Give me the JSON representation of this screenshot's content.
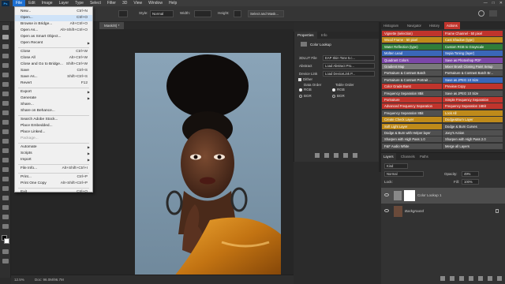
{
  "menubar": {
    "logo": "Ps",
    "items": [
      "File",
      "Edit",
      "Image",
      "Layer",
      "Type",
      "Select",
      "Filter",
      "3D",
      "View",
      "Window",
      "Help"
    ]
  },
  "options": {
    "style_label": "Style:",
    "style_value": "Normal",
    "width_label": "Width:",
    "height_label": "Height:",
    "select_mask_button": "Select and Mask..."
  },
  "document": {
    "tab_title": "Mask/8) *"
  },
  "status": {
    "zoom": "12.5%",
    "doc_size": "Doc: 96.0M/96.7M"
  },
  "file_menu": {
    "items": [
      {
        "label": "New...",
        "shortcut": "Ctrl+N",
        "state": "normal"
      },
      {
        "label": "Open...",
        "shortcut": "Ctrl+O",
        "state": "highlight"
      },
      {
        "label": "Browse in Bridge...",
        "shortcut": "Alt+Ctrl+O",
        "state": "normal"
      },
      {
        "label": "Open As...",
        "shortcut": "Alt+Shift+Ctrl+O",
        "state": "normal"
      },
      {
        "label": "Open as Smart Object...",
        "shortcut": "",
        "state": "normal"
      },
      {
        "label": "Open Recent",
        "shortcut": "",
        "state": "submenu"
      },
      {
        "label": "Close",
        "shortcut": "Ctrl+W",
        "state": "normal"
      },
      {
        "label": "Close All",
        "shortcut": "Alt+Ctrl+W",
        "state": "normal"
      },
      {
        "label": "Close and Go to Bridge...",
        "shortcut": "Shift+Ctrl+W",
        "state": "normal"
      },
      {
        "label": "Save",
        "shortcut": "Ctrl+S",
        "state": "normal"
      },
      {
        "label": "Save As...",
        "shortcut": "Shift+Ctrl+S",
        "state": "normal"
      },
      {
        "label": "Revert",
        "shortcut": "F12",
        "state": "normal"
      },
      {
        "label": "Export",
        "shortcut": "",
        "state": "submenu"
      },
      {
        "label": "Generate",
        "shortcut": "",
        "state": "submenu"
      },
      {
        "label": "Share...",
        "shortcut": "",
        "state": "normal"
      },
      {
        "label": "Share on Behance...",
        "shortcut": "",
        "state": "normal"
      },
      {
        "label": "Search Adobe Stock...",
        "shortcut": "",
        "state": "normal"
      },
      {
        "label": "Place Embedded...",
        "shortcut": "",
        "state": "normal"
      },
      {
        "label": "Place Linked...",
        "shortcut": "",
        "state": "normal"
      },
      {
        "label": "Package...",
        "shortcut": "",
        "state": "disabled"
      },
      {
        "label": "Automate",
        "shortcut": "",
        "state": "submenu"
      },
      {
        "label": "Scripts",
        "shortcut": "",
        "state": "submenu"
      },
      {
        "label": "Import",
        "shortcut": "",
        "state": "submenu"
      },
      {
        "label": "File Info...",
        "shortcut": "Alt+Shift+Ctrl+I",
        "state": "normal"
      },
      {
        "label": "Print...",
        "shortcut": "Ctrl+P",
        "state": "normal"
      },
      {
        "label": "Print One Copy",
        "shortcut": "Alt+Shift+Ctrl+P",
        "state": "normal"
      },
      {
        "label": "Exit",
        "shortcut": "Ctrl+Q",
        "state": "normal"
      }
    ]
  },
  "properties": {
    "tabs": [
      "Properties",
      "Info"
    ],
    "header": "Color Lookup",
    "rows": [
      {
        "label": "3DLUT File",
        "value": "EAP Skin Tone 5.c..."
      },
      {
        "label": "Abstract",
        "value": "Load Abstract Pro..."
      },
      {
        "label": "Device Link",
        "value": "Load DeviceLink P..."
      }
    ],
    "dither_label": "Dither",
    "data_order_label": "Data Order",
    "table_order_label": "Table Order",
    "rgb": "RGB",
    "bgr": "BGR"
  },
  "actions": {
    "tabs": [
      "Histogram",
      "Navigator",
      "History",
      "Actions"
    ],
    "active_tab": "Actions",
    "left": [
      {
        "label": "Vignette (selection)",
        "color": "#c0342c"
      },
      {
        "label": "Frame Channel - 50 pixel",
        "color": "#c0342c"
      },
      {
        "label": "Wood Frame - 50 pixel",
        "color": "#bf8a1a"
      },
      {
        "label": "Cast Shadow (type)",
        "color": "#bf8a1a"
      },
      {
        "label": "Water Reflection (type)",
        "color": "#2f7d3a"
      },
      {
        "label": "Custom RGB to Grayscale",
        "color": "#2f7d3a"
      },
      {
        "label": "Molten Lead",
        "color": "#3a67b8"
      },
      {
        "label": "Sepia Toning (layer)",
        "color": "#3a67b8"
      },
      {
        "label": "Quadrant Colors",
        "color": "#7b47a8"
      },
      {
        "label": "Save as Photoshop PDF",
        "color": "#7b47a8"
      },
      {
        "label": "Gradient Map",
        "color": "#7a7a7a"
      },
      {
        "label": "Mixer Brush Cloning Paint Setup",
        "color": "#7a7a7a"
      },
      {
        "label": "Portraiture & Contrast Batch",
        "color": "#505050"
      },
      {
        "label": "Portraiture & Contrast Batch Br...",
        "color": "#505050"
      },
      {
        "label": "Portraiture & Contrast Portrait ...",
        "color": "#505050"
      },
      {
        "label": "Save as JPEG 10 Size",
        "color": "#3a67b8"
      },
      {
        "label": "Color Grade Burst",
        "color": "#c0342c"
      },
      {
        "label": "Preview Copy",
        "color": "#c0342c"
      },
      {
        "label": "Frequency Separation 8Bit",
        "color": "#505050"
      },
      {
        "label": "Save as JPEG 10 Size",
        "color": "#505050"
      },
      {
        "label": "Portraiture",
        "color": "#c0342c"
      },
      {
        "label": "Simple Frequency Separation",
        "color": "#c0342c"
      },
      {
        "label": "Advanced Frequency Separation",
        "color": "#c0342c"
      },
      {
        "label": "Frequency Separation 16Bit",
        "color": "#c0342c"
      },
      {
        "label": "Frequency Separation 8Bit",
        "color": "#505050"
      },
      {
        "label": "Lock All",
        "color": "#bf8a1a"
      },
      {
        "label": "Create Check Layer",
        "color": "#bf8a1a"
      },
      {
        "label": "Dodge&Burn Layer",
        "color": "#bf8a1a"
      },
      {
        "label": "Soft Light Layer",
        "color": "#bf8a1a"
      },
      {
        "label": "Dodge & Burn Curves",
        "color": "#505050"
      },
      {
        "label": "Dodge & Burn with Helper layer",
        "color": "#505050"
      },
      {
        "label": "Joey's Action",
        "color": "#505050"
      },
      {
        "label": "Sharpen with High Pass 1.0",
        "color": "#505050"
      },
      {
        "label": "Sharpen with High Pass 2.0",
        "color": "#505050"
      },
      {
        "label": "F&F Audio White",
        "color": "#505050"
      },
      {
        "label": "Merge all Layers",
        "color": "#505050"
      }
    ]
  },
  "layers": {
    "tabs": [
      "Layers",
      "Channels",
      "Paths"
    ],
    "kind_label": "Kind",
    "blend_mode": "Normal",
    "opacity_label": "Opacity:",
    "opacity_value": "49%",
    "lock_label": "Lock:",
    "fill_label": "Fill:",
    "fill_value": "100%",
    "items": [
      {
        "name": "Color Lookup 1",
        "selected": true
      },
      {
        "name": "Background",
        "selected": false
      }
    ]
  }
}
